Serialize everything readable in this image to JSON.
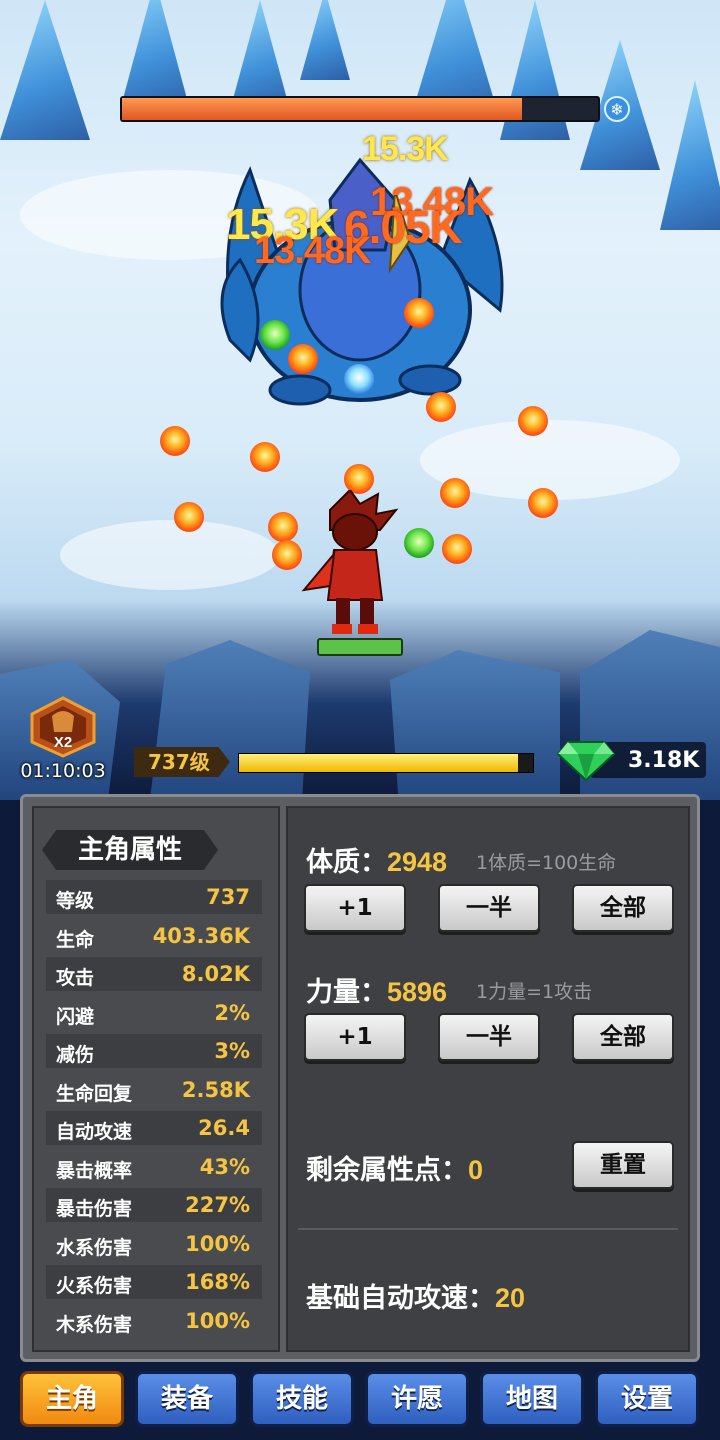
{
  "boss": {
    "hp_fraction": 0.84,
    "element_icon": "snowflake-icon"
  },
  "damage_numbers": [
    {
      "text": "15.3K",
      "color": "yellow"
    },
    {
      "text": "13.48K",
      "color": "orange"
    },
    {
      "text": "15.3K",
      "color": "yellow"
    },
    {
      "text": "6.05K",
      "color": "orange"
    },
    {
      "text": "13.48K",
      "color": "orange"
    }
  ],
  "boost": {
    "multiplier": "X2",
    "timer": "01:10:03",
    "icon": "x2-boost-icon"
  },
  "player": {
    "level_label": "737级",
    "exp_fraction": 0.95
  },
  "currency": {
    "gems": "3.18K",
    "icon": "green-gem-icon"
  },
  "stats_panel": {
    "title": "主角属性",
    "rows": [
      {
        "name": "等级",
        "value": "737"
      },
      {
        "name": "生命",
        "value": "403.36K"
      },
      {
        "name": "攻击",
        "value": "8.02K"
      },
      {
        "name": "闪避",
        "value": "2%"
      },
      {
        "name": "减伤",
        "value": "3%"
      },
      {
        "name": "生命回复",
        "value": "2.58K"
      },
      {
        "name": "自动攻速",
        "value": "26.4"
      },
      {
        "name": "暴击概率",
        "value": "43%"
      },
      {
        "name": "暴击伤害",
        "value": "227%"
      },
      {
        "name": "水系伤害",
        "value": "100%"
      },
      {
        "name": "火系伤害",
        "value": "168%"
      },
      {
        "name": "木系伤害",
        "value": "100%"
      }
    ]
  },
  "attributes": {
    "constitution": {
      "label": "体质：",
      "value": "2948",
      "hint": "1体质=100生命"
    },
    "strength": {
      "label": "力量：",
      "value": "5896",
      "hint": "1力量=1攻击"
    },
    "buttons": {
      "plus_one": "+1",
      "half": "一半",
      "all": "全部"
    },
    "remaining": {
      "label": "剩余属性点：",
      "value": "0",
      "reset": "重置"
    },
    "base_speed": {
      "label": "基础自动攻速：",
      "value": "20"
    }
  },
  "nav": {
    "items": [
      {
        "label": "主角",
        "active": true
      },
      {
        "label": "装备",
        "active": false
      },
      {
        "label": "技能",
        "active": false
      },
      {
        "label": "许愿",
        "active": false
      },
      {
        "label": "地图",
        "active": false
      },
      {
        "label": "设置",
        "active": false
      }
    ]
  },
  "colors": {
    "accent_gold": "#f5c542",
    "nav_active": "#f08a10",
    "nav_default": "#3d6fd0",
    "boss_hp": "#e0561e"
  }
}
